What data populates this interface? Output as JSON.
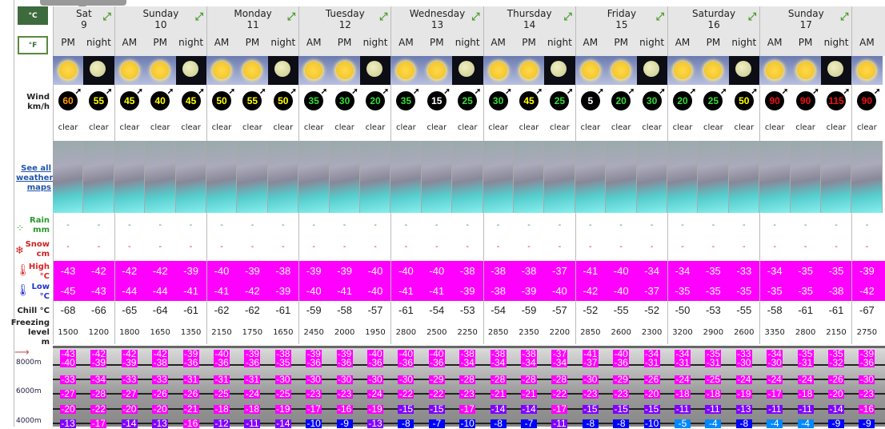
{
  "units": {
    "celsius": "°C",
    "fahrenheit": "°F"
  },
  "labels": {
    "wind": "Wind",
    "wind_unit": "km/h",
    "maps_link": "See all weather maps",
    "rain": "Rain",
    "rain_unit": "mm",
    "snow": "Snow",
    "snow_unit": "cm",
    "high": "High",
    "high_unit": "°C",
    "low": "Low",
    "low_unit": "°C",
    "chill": "Chill °C",
    "freezing": "Freezing",
    "freezing2": "level",
    "freezing3": "m",
    "alt_8000": "8000m",
    "alt_6000": "6000m",
    "alt_4000": "4000m"
  },
  "days": [
    {
      "name": "Sat",
      "num": "9",
      "cols": 2
    },
    {
      "name": "Sunday",
      "num": "10",
      "cols": 3
    },
    {
      "name": "Monday",
      "num": "11",
      "cols": 3
    },
    {
      "name": "Tuesday",
      "num": "12",
      "cols": 3
    },
    {
      "name": "Wednesday",
      "num": "13",
      "cols": 3
    },
    {
      "name": "Thursday",
      "num": "14",
      "cols": 3
    },
    {
      "name": "Friday",
      "num": "15",
      "cols": 3
    },
    {
      "name": "Saturday",
      "num": "16",
      "cols": 3
    },
    {
      "name": "Sunday",
      "num": "17",
      "cols": 3
    },
    {
      "name": "",
      "num": "",
      "cols": 1
    }
  ],
  "periods": [
    "PM",
    "night",
    "AM",
    "PM",
    "night",
    "AM",
    "PM",
    "night",
    "AM",
    "PM",
    "night",
    "AM",
    "PM",
    "night",
    "AM",
    "PM",
    "night",
    "AM",
    "PM",
    "night",
    "AM",
    "PM",
    "night",
    "AM",
    "PM",
    "night",
    "AM"
  ],
  "wind": [
    60,
    55,
    45,
    40,
    45,
    50,
    55,
    50,
    35,
    30,
    20,
    35,
    15,
    25,
    30,
    45,
    25,
    5,
    20,
    30,
    20,
    25,
    50,
    90,
    90,
    115,
    90
  ],
  "wind_colors": {
    "white": "#ffffff",
    "green": "#33dd33",
    "yellow": "#ffff00",
    "orange": "#ff9900",
    "red": "#ee1111"
  },
  "weather": "clear",
  "rain": "-",
  "snow": "-",
  "high": [
    -43,
    -42,
    -42,
    -42,
    -39,
    -40,
    -39,
    -38,
    -39,
    -39,
    -40,
    -40,
    -40,
    -38,
    -38,
    -38,
    -37,
    -41,
    -40,
    -34,
    -34,
    -35,
    -33,
    -34,
    -35,
    -35,
    -39
  ],
  "low": [
    -45,
    -43,
    -44,
    -44,
    -41,
    -41,
    -42,
    -39,
    -40,
    -41,
    -40,
    -41,
    -41,
    -39,
    -38,
    -39,
    -40,
    -42,
    -40,
    -37,
    -35,
    -35,
    -35,
    -35,
    -35,
    -38,
    -42
  ],
  "chill": [
    -68,
    -66,
    -65,
    -64,
    -61,
    -62,
    -62,
    -61,
    -59,
    -58,
    -57,
    -61,
    -54,
    -53,
    -54,
    -59,
    -57,
    -52,
    -55,
    -52,
    -50,
    -53,
    -55,
    -58,
    -61,
    -61,
    -67
  ],
  "freezing": [
    1500,
    1200,
    1800,
    1650,
    1350,
    2150,
    1750,
    1650,
    2450,
    2000,
    1950,
    2800,
    2500,
    2250,
    2850,
    2350,
    2200,
    2850,
    2600,
    2300,
    3200,
    2900,
    2600,
    3350,
    2800,
    2150,
    2750
  ],
  "altitude_temps": [
    [
      -43,
      -42,
      -42,
      -42,
      -39,
      -40,
      -39,
      -38,
      -39,
      -39,
      -40,
      -40,
      -40,
      -38,
      -38,
      -38,
      -37,
      -41,
      -40,
      -34,
      -34,
      -35,
      -33,
      -34,
      -35,
      -35,
      -39
    ],
    [
      -40,
      -39,
      -39,
      -38,
      -36,
      -36,
      -36,
      -35,
      -36,
      -36,
      -36,
      -36,
      -36,
      -34,
      -34,
      -34,
      -34,
      -37,
      -36,
      -31,
      -31,
      -31,
      -30,
      -30,
      -31,
      -32,
      -36
    ],
    [
      -33,
      -34,
      -33,
      -33,
      -31,
      -31,
      -31,
      -30,
      -30,
      -30,
      -30,
      -30,
      -29,
      -28,
      -28,
      -28,
      -28,
      -30,
      -29,
      -26,
      -24,
      -25,
      -24,
      -24,
      -24,
      -26,
      -30
    ],
    [
      -27,
      -28,
      -27,
      -26,
      -26,
      -25,
      -24,
      -25,
      -23,
      -23,
      -24,
      -22,
      -22,
      -23,
      -21,
      -21,
      -22,
      -23,
      -23,
      -20,
      -18,
      -18,
      -19,
      -17,
      -18,
      -20,
      -23
    ],
    [
      -20,
      -22,
      -20,
      -20,
      -21,
      -18,
      -18,
      -19,
      -17,
      -16,
      -19,
      -15,
      -15,
      -17,
      -14,
      -14,
      -17,
      -15,
      -15,
      -15,
      -11,
      -11,
      -13,
      -11,
      -11,
      -14,
      -16
    ],
    [
      -13,
      -17,
      -14,
      -13,
      -16,
      -12,
      -11,
      -14,
      -10,
      -9,
      -13,
      -8,
      -7,
      -10,
      -8,
      -7,
      -11,
      -8,
      -8,
      -10,
      -5,
      -4,
      -8,
      -4,
      -4,
      -9,
      -9
    ]
  ],
  "temp_colors": {
    "very_cold": "#ff00ff",
    "cold": "#8000ff",
    "cool": "#0000ff",
    "mild": "#0088ff"
  },
  "colors": {
    "header_bg": "#e6e6e6",
    "celsius_active": "#3d6b3d",
    "high_low_bg": "#ff00ff"
  }
}
